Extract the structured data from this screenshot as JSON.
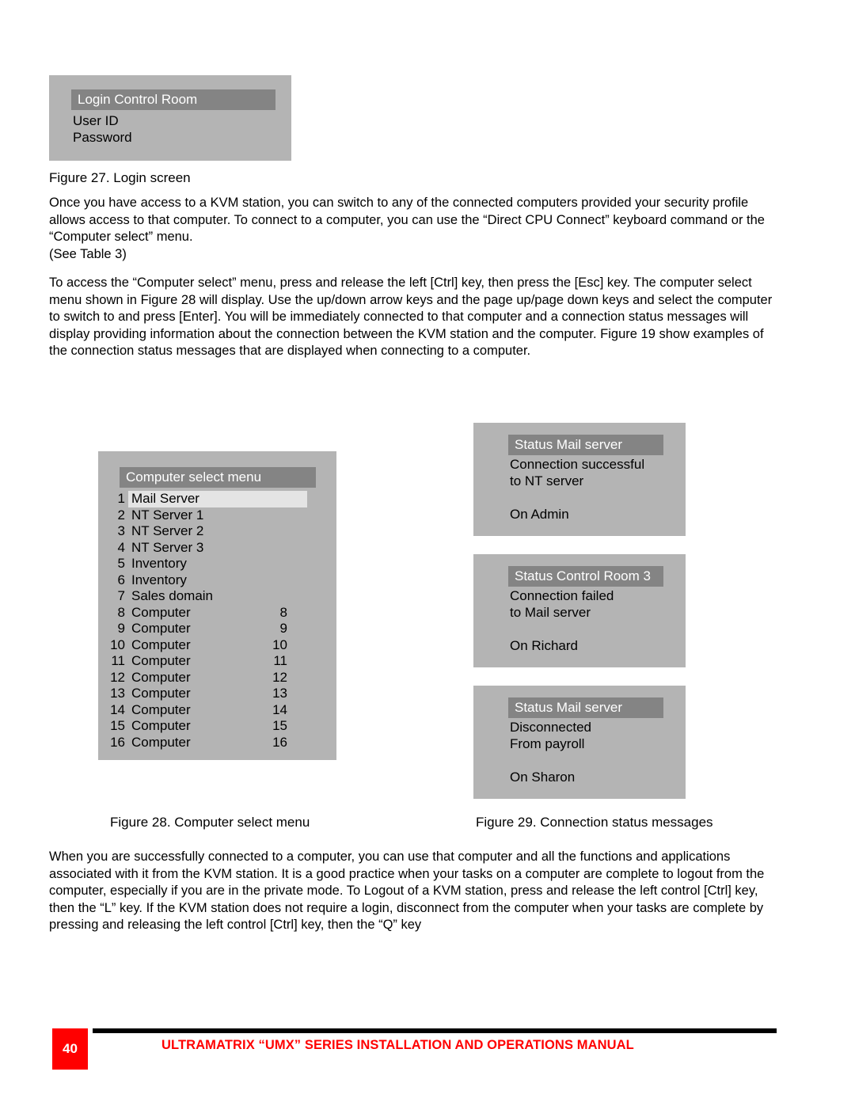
{
  "figure27": {
    "title": "Login  Control Room",
    "fields": [
      "User ID",
      "Password"
    ],
    "caption": "Figure 27. Login screen"
  },
  "paragraphs": {
    "p1": "Once you have access to a KVM station, you can switch to any of the connected computers provided your security profile allows access to that computer.  To connect to a computer, you can use the “Direct CPU Connect” keyboard command or the “Computer select” menu.",
    "p1b": "(See Table 3)",
    "p2": "To access the “Computer select” menu, press and release the left [Ctrl] key, then press the [Esc] key.  The computer select menu shown in Figure 28 will display.  Use the up/down arrow keys and the page up/page down keys and select the computer to switch to and press [Enter]. You will be immediately connected to that computer and a connection status messages will display providing information about the connection between the KVM station and the computer.  Figure 19 show examples of the connection status messages that are displayed when connecting to a computer.",
    "p3": "When you are successfully connected to a computer, you can use that computer and all the functions and applications associated with it from the KVM station.  It is a good practice when your tasks on a computer are complete to logout from the computer, especially if you are in the private mode.  To Logout of a KVM station, press and release the left control [Ctrl] key, then the “L” key. If the KVM station does not require a login, disconnect from the computer when your tasks are complete by pressing and releasing the left control [Ctrl] key, then the “Q” key"
  },
  "figure28": {
    "title": "Computer select menu",
    "caption": "Figure 28. Computer select menu",
    "rows": [
      {
        "index": "1",
        "name": "Mail Server",
        "port": "",
        "selected": true
      },
      {
        "index": "2",
        "name": "NT Server 1",
        "port": "",
        "selected": false
      },
      {
        "index": "3",
        "name": "NT Server 2",
        "port": "",
        "selected": false
      },
      {
        "index": "4",
        "name": "NT Server 3",
        "port": "",
        "selected": false
      },
      {
        "index": "5",
        "name": "Inventory",
        "port": "",
        "selected": false
      },
      {
        "index": "6",
        "name": "Inventory",
        "port": "",
        "selected": false
      },
      {
        "index": "7",
        "name": "Sales domain",
        "port": "",
        "selected": false
      },
      {
        "index": "8",
        "name": "Computer",
        "port": "8",
        "selected": false
      },
      {
        "index": "9",
        "name": "Computer",
        "port": "9",
        "selected": false
      },
      {
        "index": "10",
        "name": "Computer",
        "port": "10",
        "selected": false
      },
      {
        "index": "11",
        "name": "Computer",
        "port": "11",
        "selected": false
      },
      {
        "index": "12",
        "name": "Computer",
        "port": "12",
        "selected": false
      },
      {
        "index": "13",
        "name": "Computer",
        "port": "13",
        "selected": false
      },
      {
        "index": "14",
        "name": "Computer",
        "port": "14",
        "selected": false
      },
      {
        "index": "15",
        "name": "Computer",
        "port": "15",
        "selected": false
      },
      {
        "index": "16",
        "name": "Computer",
        "port": "16",
        "selected": false
      }
    ]
  },
  "figure29": {
    "caption": "Figure 29. Connection status messages",
    "panels": [
      {
        "title": "Status Mail server",
        "line1": "Connection successful",
        "line2": "to NT server",
        "line3": "On Admin"
      },
      {
        "title": "Status Control Room 3",
        "line1": "Connection failed",
        "line2": "to Mail server",
        "line3": "On Richard"
      },
      {
        "title": "Status Mail server",
        "line1": "Disconnected",
        "line2": "From payroll",
        "line3": "On Sharon"
      }
    ]
  },
  "footer": {
    "page_number": "40",
    "title": "ULTRAMATRIX “UMX” SERIES INSTALLATION AND OPERATIONS MANUAL",
    "rule_color": "#000000",
    "page_box_color": "#ff0000",
    "title_color": "#ff0000"
  }
}
